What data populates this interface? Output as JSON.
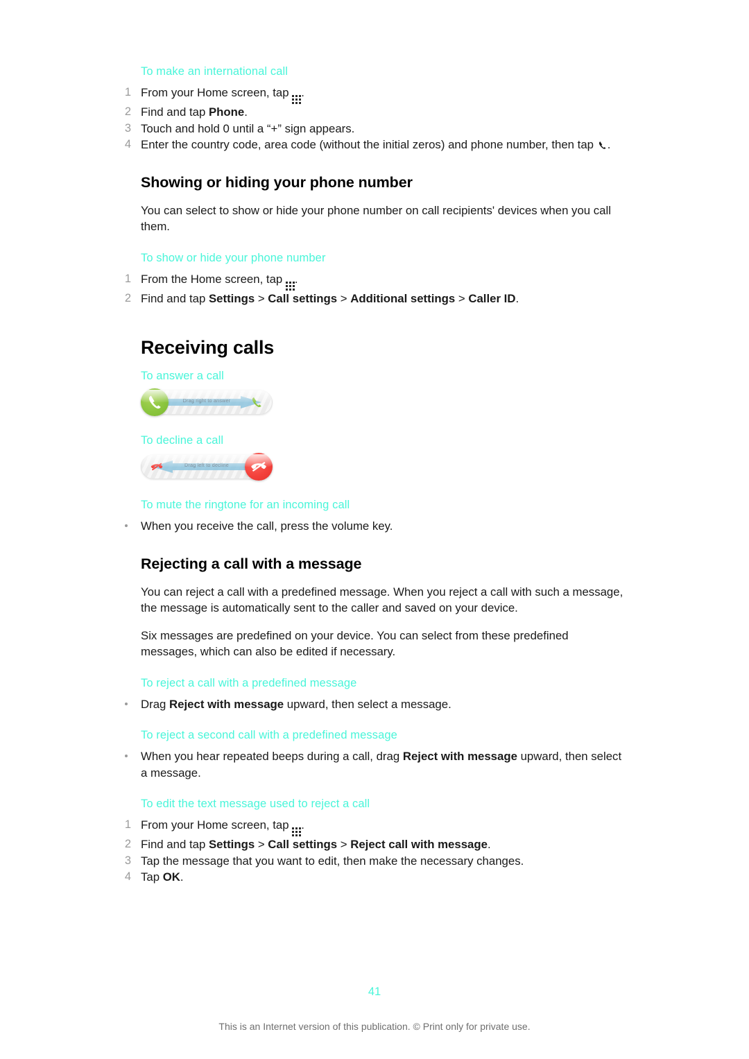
{
  "document": {
    "page_number": "41",
    "disclaimer": "This is an Internet version of this publication. © Print only for private use.",
    "heading_color": "#49f5d9",
    "body_color": "#1a1a1a",
    "number_color": "#9a9a9a"
  },
  "sections": {
    "international_call": {
      "heading": "To make an international call",
      "steps": [
        {
          "num": "1",
          "pre": "From your Home screen, tap ",
          "icon": "app-grid-icon",
          "post": "."
        },
        {
          "num": "2",
          "pre": "Find and tap ",
          "bold": "Phone",
          "post": "."
        },
        {
          "num": "3",
          "pre": "Touch and hold 0 until a “+” sign appears.",
          "post": ""
        },
        {
          "num": "4",
          "pre": "Enter the country code, area code (without the initial zeros) and phone number, then tap ",
          "icon": "phone-handset-icon",
          "post": "."
        }
      ]
    },
    "showing_hiding": {
      "title": "Showing or hiding your phone number",
      "paragraph": "You can select to show or hide your phone number on call recipients' devices when you call them.",
      "heading": "To show or hide your phone number",
      "steps": [
        {
          "num": "1",
          "pre": "From the Home screen, tap ",
          "icon": "app-grid-icon",
          "post": "."
        },
        {
          "num": "2",
          "pre": "Find and tap ",
          "crumbs": [
            "Settings",
            "Call settings",
            "Additional settings",
            "Caller ID"
          ],
          "separator": " > ",
          "post": "."
        }
      ]
    },
    "receiving_calls": {
      "title": "Receiving calls",
      "answer": {
        "heading": "To answer a call",
        "widget": {
          "name": "drag-right-to-answer-slider",
          "label": "Drag right to answer",
          "direction": "right",
          "knob_color": "#8cc63f",
          "band_color": "#8ec4de",
          "end_icon": "phone-answer-icon"
        }
      },
      "decline": {
        "heading": "To decline a call",
        "widget": {
          "name": "drag-left-to-decline-slider",
          "label": "Drag left to decline",
          "direction": "left",
          "knob_color": "#f4423c",
          "band_color": "#8ec4de",
          "end_icon": "phone-decline-icon"
        }
      },
      "mute": {
        "heading": "To mute the ringtone for an incoming call",
        "bullets": [
          {
            "pre": "When you receive the call, press the volume key.",
            "post": ""
          }
        ]
      }
    },
    "rejecting": {
      "title": "Rejecting a call with a message",
      "paragraph_1": "You can reject a call with a predefined message. When you reject a call with such a message, the message is automatically sent to the caller and saved on your device.",
      "paragraph_2": "Six messages are predefined on your device. You can select from these predefined messages, which can also be edited if necessary.",
      "reject_predefined": {
        "heading": "To reject a call with a predefined message",
        "bullets": [
          {
            "pre": "Drag ",
            "bold": "Reject with message",
            "post": " upward, then select a message."
          }
        ]
      },
      "reject_second": {
        "heading": "To reject a second call with a predefined message",
        "bullets": [
          {
            "pre": "When you hear repeated beeps during a call, drag ",
            "bold": "Reject with message",
            "post": " upward, then select a message."
          }
        ]
      },
      "edit_text": {
        "heading": "To edit the text message used to reject a call",
        "steps": [
          {
            "num": "1",
            "pre": "From your Home screen, tap ",
            "icon": "app-grid-icon",
            "post": "."
          },
          {
            "num": "2",
            "pre": "Find and tap ",
            "crumbs": [
              "Settings",
              "Call settings",
              "Reject call with message"
            ],
            "separator": " > ",
            "post": "."
          },
          {
            "num": "3",
            "pre": "Tap the message that you want to edit, then make the necessary changes.",
            "post": ""
          },
          {
            "num": "4",
            "pre": "Tap ",
            "bold": "OK",
            "post": "."
          }
        ]
      }
    }
  }
}
